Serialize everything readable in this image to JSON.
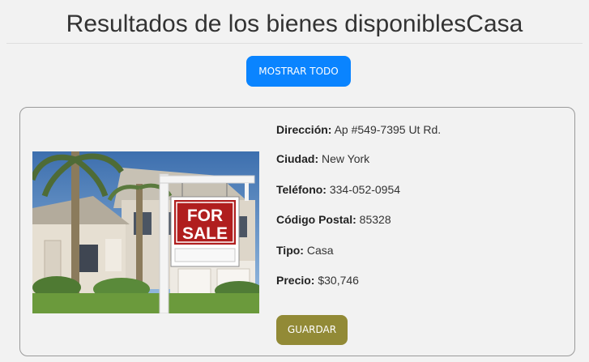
{
  "header": {
    "title": "Resultados de los bienes disponiblesCasa"
  },
  "actions": {
    "show_all_label": "MOSTRAR TODO"
  },
  "listing": {
    "image": {
      "sign_top": "FOR",
      "sign_bottom": "SALE"
    },
    "fields": {
      "direccion": {
        "label": "Dirección:",
        "value": "Ap #549-7395 Ut Rd."
      },
      "ciudad": {
        "label": "Ciudad:",
        "value": "New York"
      },
      "telefono": {
        "label": "Teléfono:",
        "value": "334-052-0954"
      },
      "codigo_postal": {
        "label": "Código Postal:",
        "value": "85328"
      },
      "tipo": {
        "label": "Tipo:",
        "value": "Casa"
      },
      "precio": {
        "label": "Precio:",
        "value": "$30,746"
      }
    },
    "save_label": "GUARDAR"
  },
  "colors": {
    "primary_button": "#0a84ff",
    "save_button": "#928a36",
    "page_background": "#f2f2f2"
  }
}
